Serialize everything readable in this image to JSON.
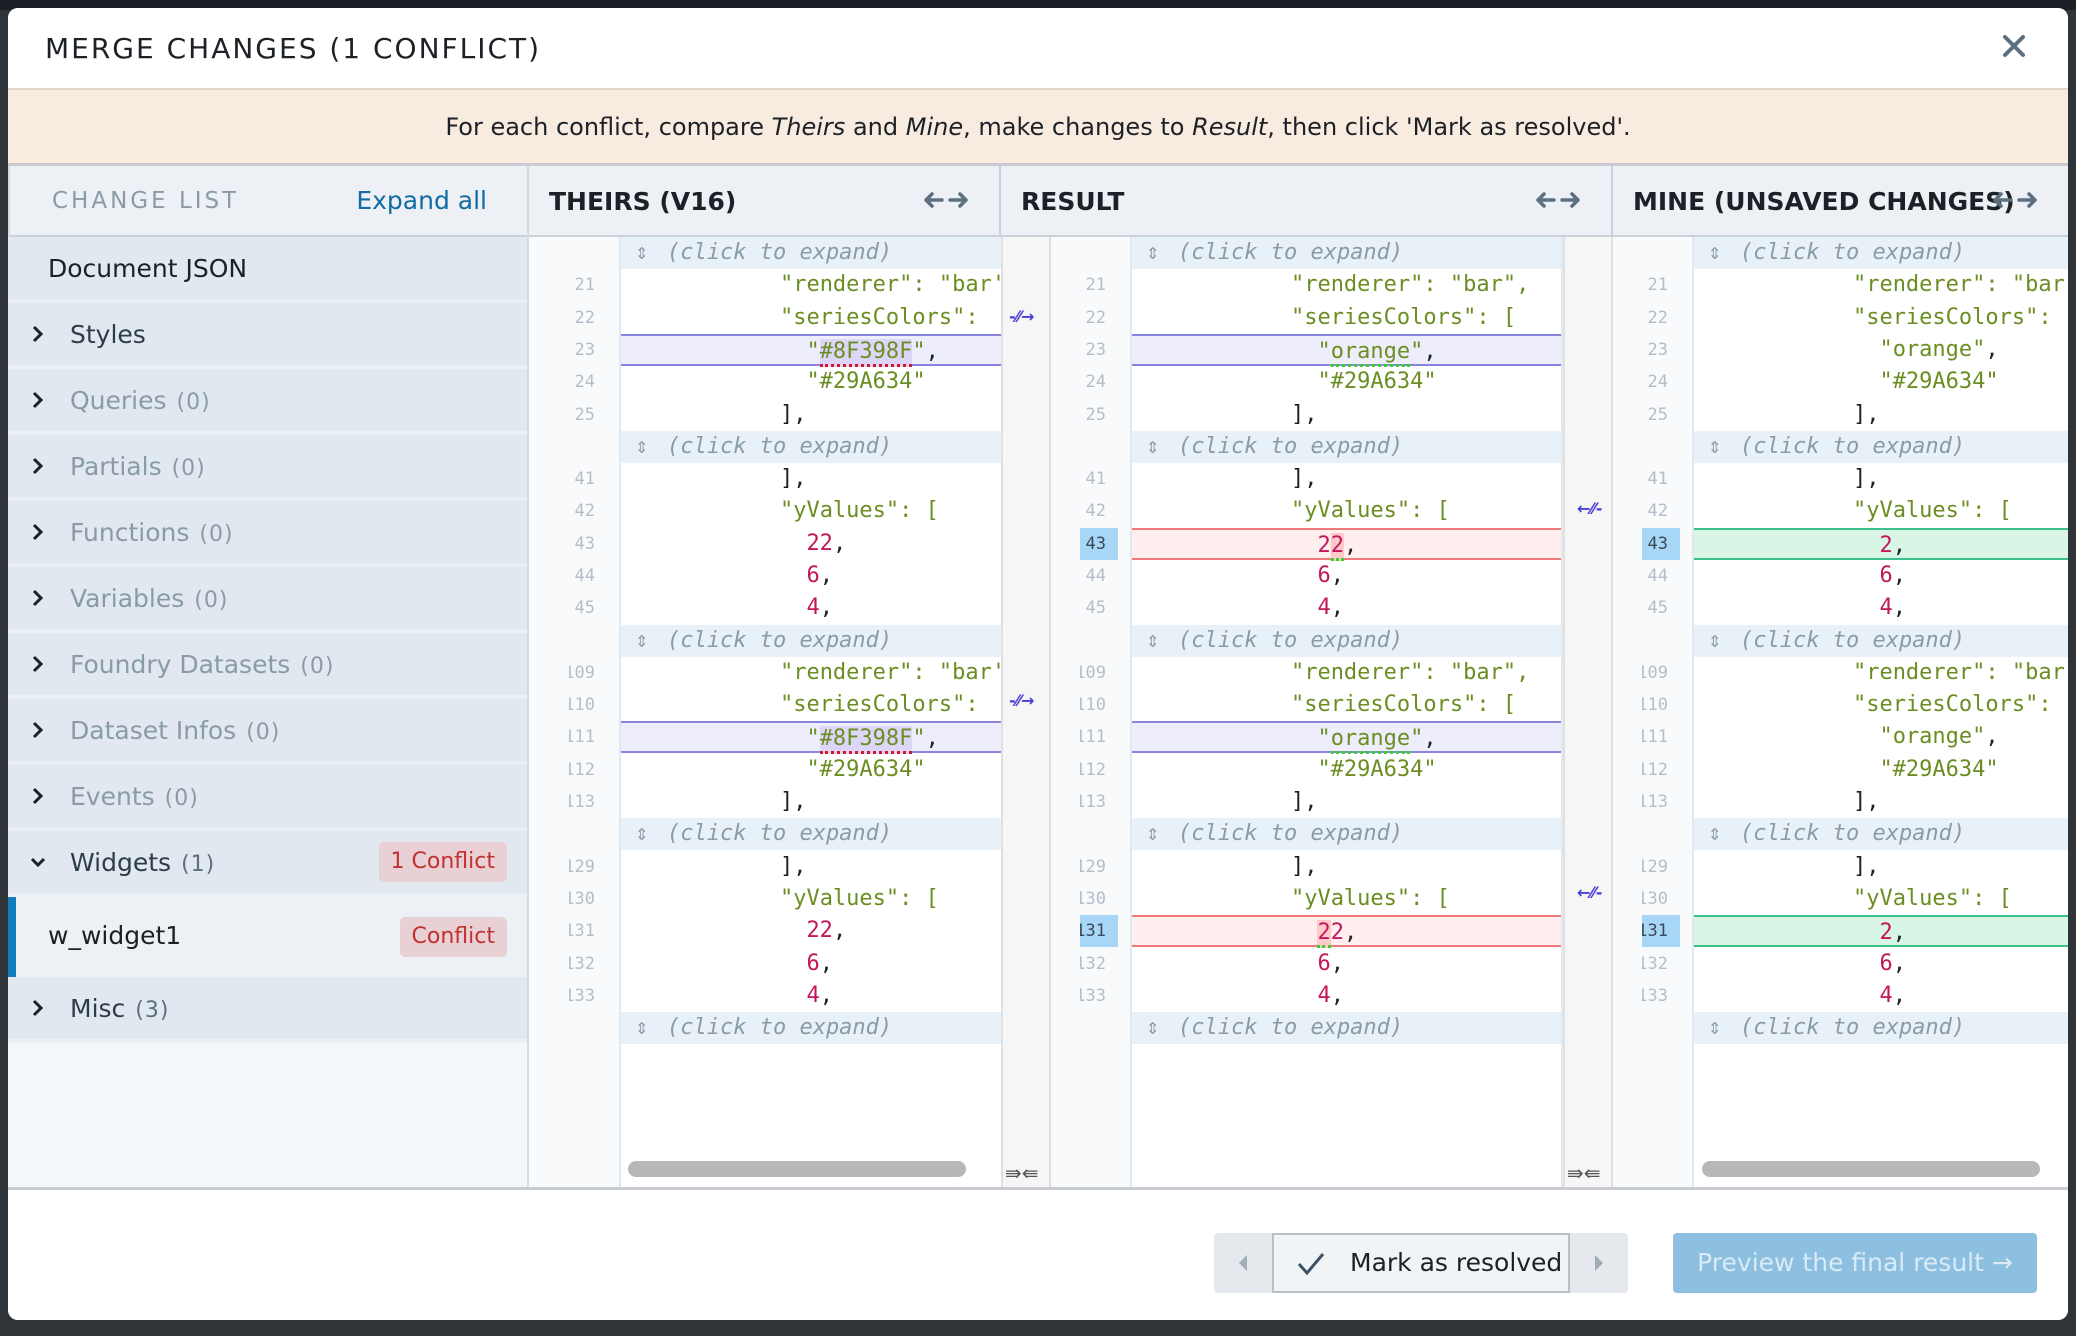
{
  "dialog": {
    "title": "MERGE CHANGES (1 CONFLICT)",
    "close_label": "×"
  },
  "banner": {
    "p1": "For each conflict, compare ",
    "theirs": "Theirs",
    "p2": " and ",
    "mine": "Mine",
    "p3": ", make changes to ",
    "result": "Result",
    "p4": ", then click 'Mark as resolved'."
  },
  "sidebar": {
    "header": "CHANGE LIST",
    "expand_all": "Expand all",
    "document": "Document JSON",
    "items": [
      {
        "label": "Styles",
        "count": ""
      },
      {
        "label": "Queries",
        "count": "(0)"
      },
      {
        "label": "Partials",
        "count": "(0)"
      },
      {
        "label": "Functions",
        "count": "(0)"
      },
      {
        "label": "Variables",
        "count": "(0)"
      },
      {
        "label": "Foundry Datasets",
        "count": "(0)"
      },
      {
        "label": "Dataset Infos",
        "count": "(0)"
      },
      {
        "label": "Events",
        "count": "(0)"
      },
      {
        "label": "Widgets",
        "count": "(1)",
        "badge": "1 Conflict"
      },
      {
        "label": "Misc",
        "count": "(3)"
      }
    ],
    "child": {
      "label": "w_widget1",
      "badge": "Conflict"
    }
  },
  "panes": {
    "theirs": {
      "title": "THEIRS (V16)"
    },
    "result": {
      "title": "RESULT"
    },
    "mine": {
      "title": "MINE (UNSAVED CHANGES)"
    }
  },
  "code": {
    "fold_label": "(click to expand)",
    "line_numbers": [
      "21",
      "22",
      "23",
      "24",
      "25",
      "41",
      "42",
      "43",
      "44",
      "45",
      "109",
      "110",
      "111",
      "112",
      "113",
      "129",
      "130",
      "131",
      "132",
      "133"
    ],
    "theirs": {
      "l21": "\"renderer\": \"bar'",
      "l22": "\"seriesColors\": ",
      "l23_color": "#8F398F",
      "l24": "\"#29A634\"",
      "l25": "],",
      "l41": "],",
      "l42": "\"yValues\": [",
      "l43": "22",
      "l44": "6",
      "l45": "4"
    },
    "result": {
      "l21": "\"renderer\": \"bar\",",
      "l22": "\"seriesColors\": [",
      "l23_color": "orange",
      "l24": "\"#29A634\"",
      "l25": "],",
      "l41": "],",
      "l42": "\"yValues\": [",
      "l43": "22",
      "l44": "6",
      "l45": "4"
    },
    "mine": {
      "l21": "\"renderer\": \"bar'",
      "l22": "\"seriesColors\": ",
      "l23_color": "orange",
      "l24": "\"#29A634\"",
      "l25": "],",
      "l41": "],",
      "l42": "\"yValues\": [",
      "l43": "2",
      "l44": "6",
      "l45": "4"
    }
  },
  "footer": {
    "mark_resolved": "Mark as resolved",
    "preview": "Preview the final result →"
  },
  "colors": {
    "accent": "#137cbd",
    "conflict_text": "#c23030",
    "conflict_bg": "#e8d0d5",
    "banner_bg": "#f8ece0",
    "preview_bg": "#8dbfe0"
  }
}
